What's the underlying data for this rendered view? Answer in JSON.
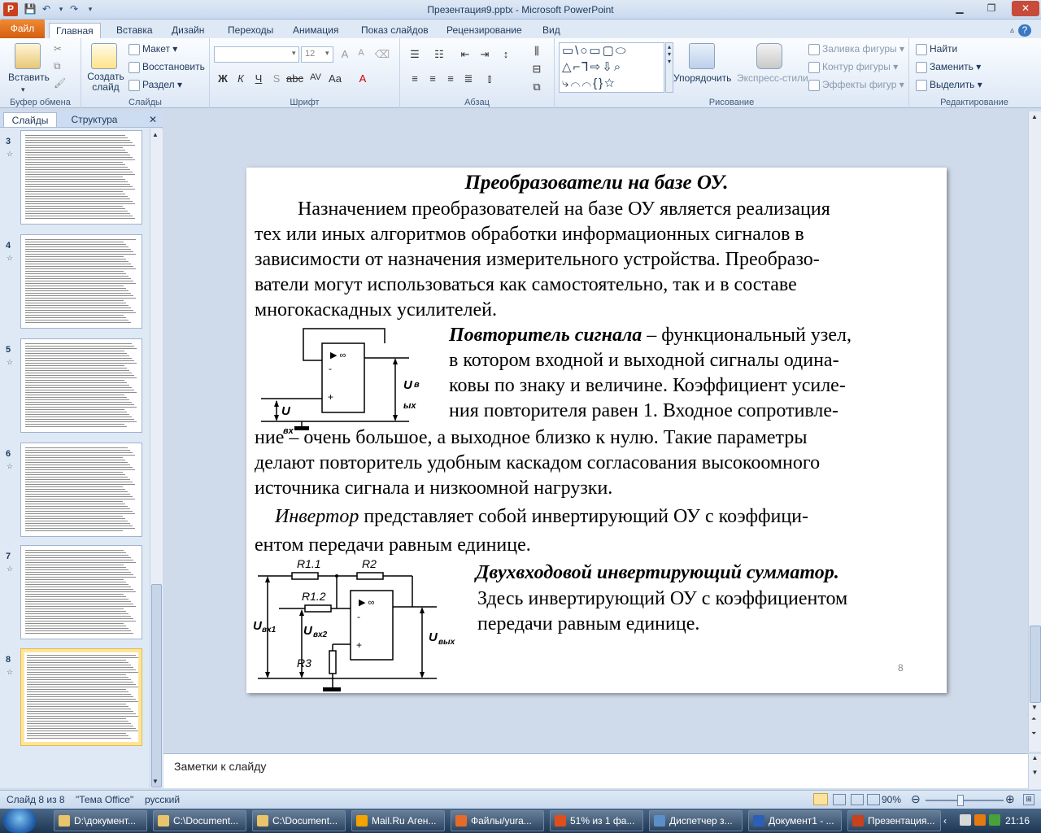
{
  "window": {
    "title": "Презентация9.pptx - Microsoft PowerPoint"
  },
  "tabs": [
    "Файл",
    "Главная",
    "Вставка",
    "Дизайн",
    "Переходы",
    "Анимация",
    "Показ слайдов",
    "Рецензирование",
    "Вид"
  ],
  "ribbon": {
    "clipboard": {
      "label": "Буфер обмена",
      "paste": "Вставить"
    },
    "slides": {
      "label": "Слайды",
      "new_slide": "Создать слайд",
      "layout": "Макет",
      "reset": "Восстановить",
      "section": "Раздел"
    },
    "font": {
      "label": "Шрифт",
      "font_name": "",
      "font_size": "12"
    },
    "paragraph": {
      "label": "Абзац"
    },
    "drawing": {
      "label": "Рисование",
      "arrange": "Упорядочить",
      "quick_styles": "Экспресс-стили",
      "fill": "Заливка фигуры",
      "outline": "Контур фигуры",
      "effects": "Эффекты фигур"
    },
    "editing": {
      "label": "Редактирование",
      "find": "Найти",
      "replace": "Заменить",
      "select": "Выделить"
    }
  },
  "panel": {
    "tab_slides": "Слайды",
    "tab_outline": "Структура",
    "thumbnails": [
      "3",
      "4",
      "5",
      "6",
      "7",
      "8"
    ],
    "selected": "8"
  },
  "slide": {
    "title": "Преобразователи на базе ОУ.",
    "p1": [
      "Назначением преобразователей на базе ОУ является реализация",
      "тех или иных алгоритмов обработки информационных сигналов в",
      "зависимости от назначения измерительного устройства. Преобразо-",
      "ватели могут использоваться как самостоятельно, так и в составе",
      "многокаскадных усилителей."
    ],
    "follower_term": "Повторитель сигнала",
    "follower_lines": [
      " – функциональный узел,",
      "в котором входной и выходной сигналы одина-",
      "ковы по знаку и величине. Коэффициент усиле-",
      "ния повторителя равен 1. Входное сопротивле-"
    ],
    "p2": [
      "ние – очень большое, а выходное близко к нулю. Такие параметры",
      "делают повторитель удобным каскадом согласования высокоомного",
      "источника сигнала и низкоомной нагрузки."
    ],
    "inverter_term": "Инвертор",
    "inverter_line1": " представляет собой инвертирующий ОУ с коэффици-",
    "inverter_line2": "ентом передачи равным единице.",
    "summator_title": "Двухвходовой инвертирующий сумматор.",
    "summator_lines": [
      "Здесь инвертирующий ОУ с коэффициентом",
      "передачи равным единице."
    ],
    "circuit1": {
      "in_label": "U",
      "in_sub": "вх",
      "out_label": "U",
      "out_sub1": "в",
      "out_sub2": "ых",
      "inf": "▶ ∞",
      "minus": "-",
      "plus": "+"
    },
    "circuit2": {
      "r11": "R1.1",
      "r2": "R2",
      "r12": "R1.2",
      "r3": "R3",
      "uvx1": "U",
      "uvx1_sub": "вх1",
      "uvx2": "U",
      "uvx2_sub": "вх2",
      "uvyh": "U",
      "uvyh_sub": "вых",
      "inf": "▶ ∞",
      "minus": "-",
      "plus": "+"
    },
    "page_number": "8"
  },
  "notes": {
    "placeholder": "Заметки к слайду"
  },
  "status": {
    "slide_info": "Слайд 8 из 8",
    "theme": "\"Тема Office\"",
    "language": "русский",
    "zoom": "90%",
    "zoom_level": 0.45
  },
  "taskbar": {
    "items": [
      "D:\\документ...",
      "C:\\Document...",
      "C:\\Document...",
      "Mail.Ru Аген...",
      "Файлы/yura...",
      "51% из 1 фа...",
      "Диспетчер з...",
      "Документ1 - ...",
      "Презентация..."
    ],
    "clock": "21:16"
  },
  "colors": {
    "accent": "#f08b33",
    "ribbon": "#dfe9f5",
    "spell": "#e02020"
  }
}
